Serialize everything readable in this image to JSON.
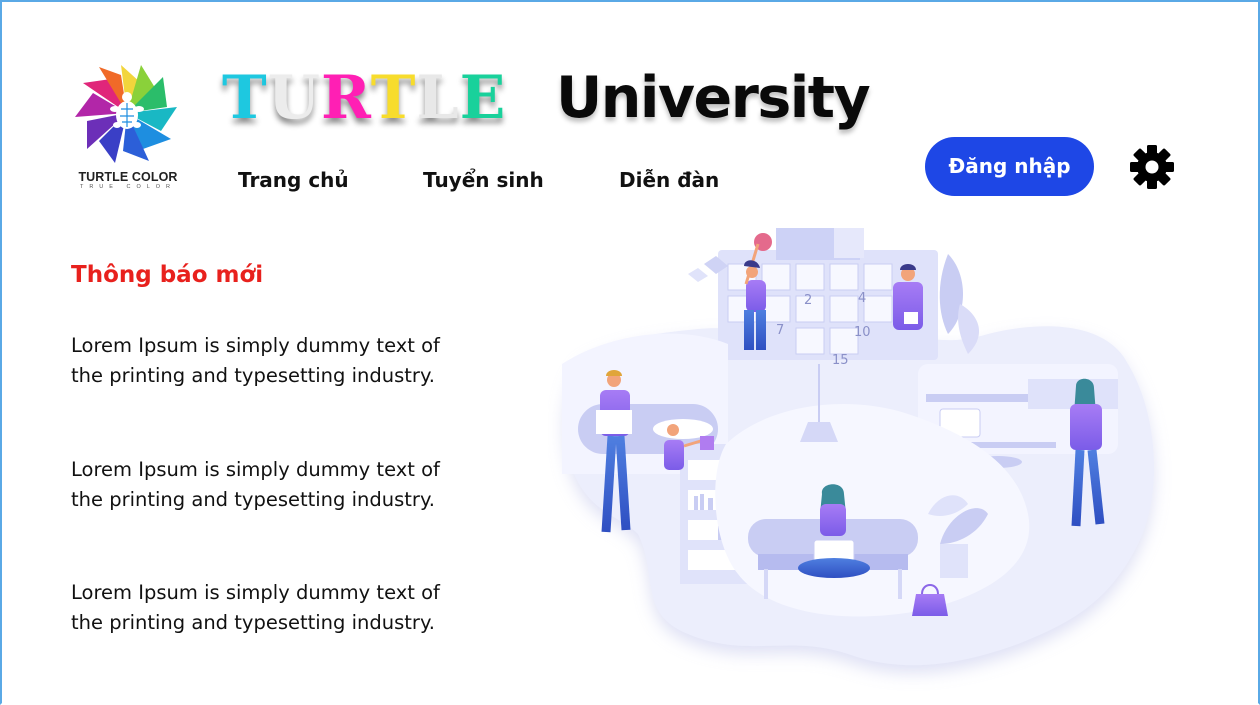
{
  "logo": {
    "title": "TURTLE COLOR",
    "subtitle": "TRUE COLOR",
    "icon": "turtle-pinwheel-logo"
  },
  "brand": {
    "letters": [
      "T",
      "U",
      "R",
      "T",
      "L",
      "E"
    ],
    "letter_colors": [
      "#1ec8e0",
      "#ececec",
      "#ff1fb4",
      "#f7dc2c",
      "#e8e8e8",
      "#19d19b"
    ],
    "word": "University"
  },
  "nav": {
    "items": [
      "Trang chủ",
      "Tuyển sinh",
      "Diễn đàn"
    ]
  },
  "auth": {
    "login_label": "Đăng nhập"
  },
  "settings": {
    "icon": "gear-icon"
  },
  "notices": {
    "title": "Thông báo mới",
    "items": [
      "Lorem Ipsum is simply dummy text of the printing and typesetting industry.",
      "Lorem Ipsum is simply dummy text of the printing and typesetting industry.",
      "Lorem Ipsum is simply dummy text of the printing and typesetting industry."
    ]
  },
  "illustration": {
    "calendar_numbers": [
      "2",
      "4",
      "7",
      "10",
      "15"
    ]
  },
  "colors": {
    "accent": "#1e47e6",
    "notice_title": "#e8211d",
    "frame": "#5aa9e6",
    "illustration_base": "#e9ebfb",
    "illustration_purple": "#9b6cf0"
  }
}
